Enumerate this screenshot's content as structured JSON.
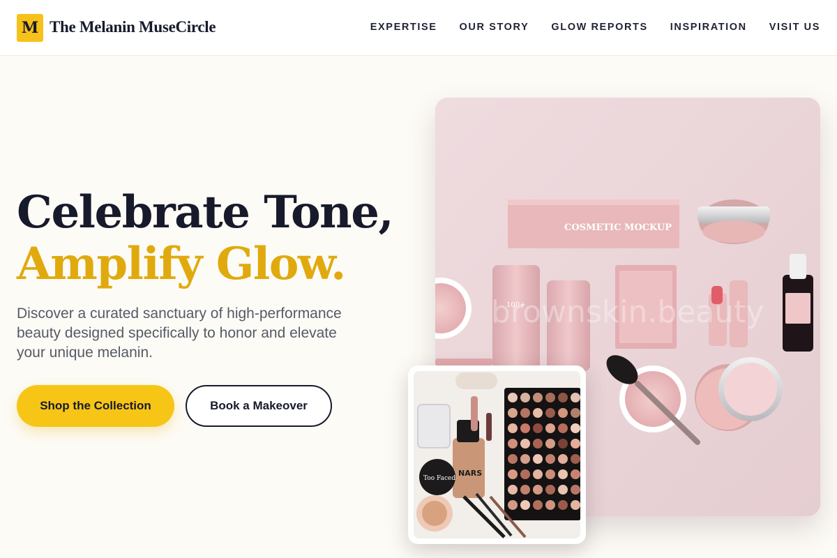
{
  "header": {
    "logo_letter": "M",
    "brand_name": "The Melanin MuseCircle",
    "nav": [
      "EXPERTISE",
      "OUR STORY",
      "GLOW REPORTS",
      "INSPIRATION",
      "VISIT US"
    ]
  },
  "hero": {
    "headline_line1": "Celebrate Tone,",
    "headline_line2": "Amplify Glow.",
    "subcopy": "Discover a curated sanctuary of high-performance beauty designed specifically to honor and elevate your unique melanin.",
    "primary_cta": "Shop the Collection",
    "secondary_cta": "Book a Makeover"
  },
  "images": {
    "main_watermark": "brownskin.beauty",
    "main_product_text": "COSMETIC MOCKUP",
    "main_product_number": "100+",
    "inset_brand_1": "Too Faced",
    "inset_brand_2": "NARS"
  },
  "colors": {
    "accent": "#f6c21a",
    "headline_accent": "#e0aa0e",
    "ink": "#161a2b",
    "background": "#fdfbf6",
    "product_pink": "#ecd7da"
  }
}
